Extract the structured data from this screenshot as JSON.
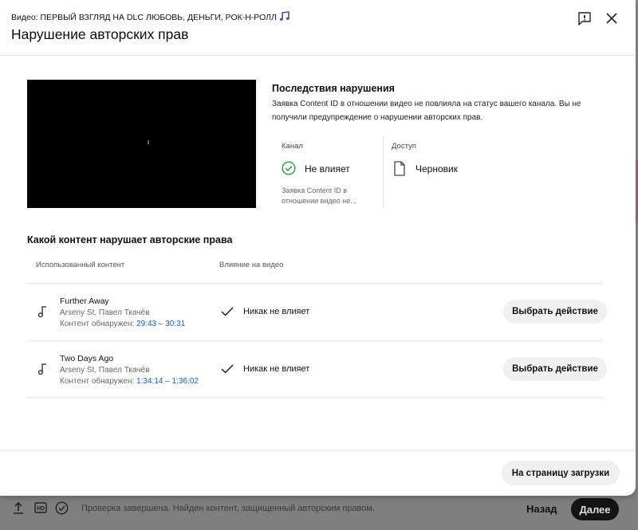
{
  "dialog": {
    "video_prefix": "Видео: ",
    "video_name": "ПЕРВЫЙ ВЗГЛЯД НА DLC ЛЮБОВЬ, ДЕНЬГИ, РОК-Н-РОЛЛ",
    "title": "Нарушение авторских прав",
    "icons": {
      "note": "music-note-icon",
      "report": "report-flag-icon",
      "close": "close-icon"
    }
  },
  "consequences": {
    "title": "Последствия нарушения",
    "text": "Заявка Content ID в отношении видео не повлияла на статус вашего канала. Вы не получили предупреждение о нарушении авторских прав.",
    "channel": {
      "label": "Канал",
      "value": "Не влияет",
      "description": "Заявка Content ID в отношении видео не...",
      "icon": "check-circle-icon",
      "color": "#2ba640"
    },
    "access": {
      "label": "Доступ",
      "value": "Черновик",
      "icon": "document-icon"
    }
  },
  "content": {
    "title": "Какой контент нарушает авторские права",
    "col_used": "Использованный контент",
    "col_impact": "Влияние на видео",
    "rows": [
      {
        "track": "Further Away",
        "artists": "Arseny St, Павел Ткачёв",
        "found_label": "Контент обнаружен: ",
        "range": "29:43 – 30:31",
        "impact": "Никак не влияет",
        "action": "Выбрать действие"
      },
      {
        "track": "Two Days Ago",
        "artists": "Arseny St, Павел Ткачёв",
        "found_label": "Контент обнаружен: ",
        "range": "1:34:14 – 1:36:02",
        "impact": "Никак не влияет",
        "action": "Выбрать действие"
      }
    ]
  },
  "footer": {
    "upload_button": "На страницу загрузки"
  },
  "background": {
    "status": "Проверка завершена. Найден контент, защищенный авторским правом.",
    "back": "Назад",
    "next": "Далее",
    "icons": [
      "upload-icon",
      "hd-icon",
      "check-circle-icon"
    ]
  },
  "colors": {
    "link": "#065fd4",
    "note_icon": "#6b3fa0",
    "check_green": "#2ba640"
  }
}
